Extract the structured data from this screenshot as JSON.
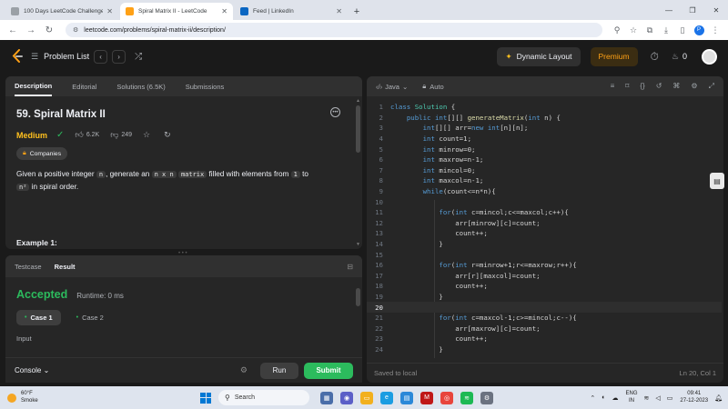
{
  "browser": {
    "tabs": [
      {
        "title": "100 Days LeetCode Challenge",
        "color": "#7a7a7a",
        "active": false
      },
      {
        "title": "Spiral Matrix II - LeetCode",
        "color": "#ffa116",
        "active": true
      },
      {
        "title": "Feed | LinkedIn",
        "color": "#0a66c2",
        "active": false
      }
    ],
    "url": "leetcode.com/problems/spiral-matrix-ii/description/",
    "profile_letter": "P"
  },
  "nav": {
    "problem_list": "Problem List",
    "dynamic_layout": "Dynamic Layout",
    "premium": "Premium",
    "fire_count": "0"
  },
  "left_tabs": [
    "Description",
    "Editorial",
    "Solutions (6.5K)",
    "Submissions"
  ],
  "problem": {
    "title": "59. Spiral Matrix II",
    "difficulty": "Medium",
    "likes": "6.2K",
    "dislikes": "249",
    "companies": "Companies",
    "text_1": "Given a positive integer ",
    "code_n": "n",
    "text_2": ", generate an ",
    "code_nxn": "n x n",
    "text_3": " ",
    "code_matrix": "matrix",
    "text_4": " filled with elements from ",
    "code_1": "1",
    "text_5": " to",
    "code_n2": "n²",
    "text_6": " in spiral order.",
    "example_heading": "Example 1:"
  },
  "result": {
    "tabs": [
      "Testcase",
      "Result"
    ],
    "status": "Accepted",
    "runtime": "Runtime: 0 ms",
    "cases": [
      "Case 1",
      "Case 2"
    ],
    "input_label": "Input"
  },
  "console": {
    "label": "Console",
    "run": "Run",
    "submit": "Submit"
  },
  "editor": {
    "language": "Java",
    "mode": "Auto",
    "status_left": "Saved to local",
    "status_right": "Ln 20, Col 1",
    "current_line": 20,
    "lines": [
      "class Solution {",
      "    public int[][] generateMatrix(int n) {",
      "        int[][] arr=new int[n][n];",
      "        int count=1;",
      "        int minrow=0;",
      "        int maxrow=n-1;",
      "        int mincol=0;",
      "        int maxcol=n-1;",
      "        while(count<=n*n){",
      "",
      "            for(int c=mincol;c<=maxcol;c++){",
      "                arr[minrow][c]=count;",
      "                count++;",
      "            }",
      "",
      "            for(int r=minrow+1;r<=maxrow;r++){",
      "                arr[r][maxcol]=count;",
      "                count++;",
      "            }",
      "",
      "            for(int c=maxcol-1;c>=mincol;c--){",
      "                arr[maxrow][c]=count;",
      "                count++;",
      "            }"
    ]
  },
  "taskbar": {
    "temp": "60°F",
    "weather": "Smoke",
    "search": "Search",
    "lang_1": "ENG",
    "lang_2": "IN",
    "time": "09:41",
    "date": "27-12-2023"
  }
}
